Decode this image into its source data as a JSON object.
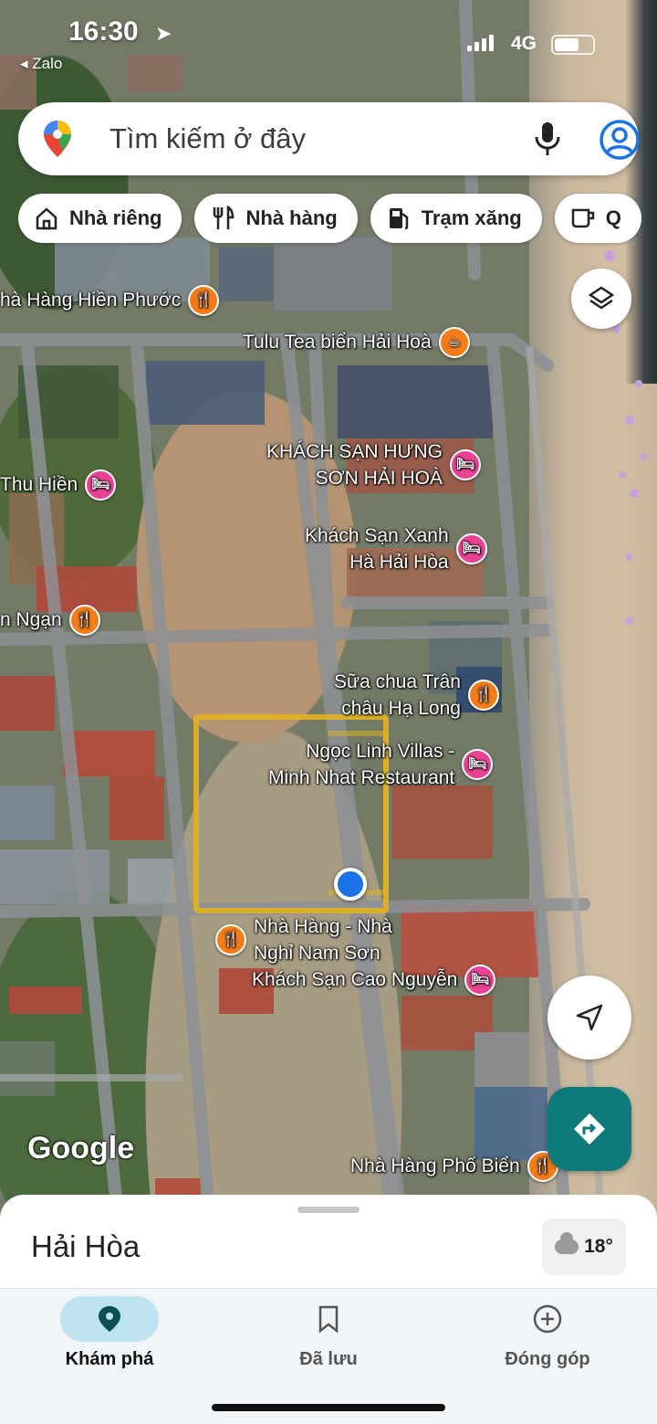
{
  "status_bar": {
    "time": "16:30",
    "back_app": "◂ Zalo",
    "network": "4G"
  },
  "search": {
    "placeholder": "Tìm kiếm ở đây",
    "icons": [
      "maps-pin-icon",
      "mic-icon",
      "account-icon"
    ]
  },
  "chips": [
    {
      "label": "Nhà riêng",
      "icon": "home-icon"
    },
    {
      "label": "Nhà hàng",
      "icon": "restaurant-icon"
    },
    {
      "label": "Trạm xăng",
      "icon": "gas-station-icon"
    },
    {
      "label": "Q",
      "icon": "cafe-icon"
    }
  ],
  "map_labels": {
    "hien_phuoc": "hà Hàng Hiền Phước",
    "tulu": "Tulu Tea biển Hải Hoà",
    "hung_son": "KHÁCH SẠN HƯNG\nSƠN HẢI HOÀ",
    "thu_hien": "Thu Hiền",
    "xanh_ha": "Khách Sạn Xanh\nHà Hải Hòa",
    "ngan": "n Ngạn",
    "sua_chua": "Sữa chua Trân\nchâu Hạ Long",
    "ngoc_linh": "Ngọc Linh Villas -\nMinh Nhat Restaurant",
    "nam_son": "Nhà Hàng - Nhà\nNghỉ Nam Sơn",
    "cao_nguyen": "Khách Sạn Cao Nguyễn",
    "pho_bien": "Nhà Hàng Phố Biển"
  },
  "map_brand": "Google",
  "colors": {
    "highlight": "#e4b320",
    "location_dot": "#1a73e8",
    "directions_fab": "#0e7a7a",
    "food_pin": "#f57c19",
    "hotel_pin": "#e84393",
    "nav_active": "#bde3f0"
  },
  "sheet": {
    "place": "Hải Hòa",
    "temperature": "18°"
  },
  "nav": [
    {
      "label": "Khám phá",
      "icon": "explore-pin-icon",
      "active": true
    },
    {
      "label": "Đã lưu",
      "icon": "bookmark-icon",
      "active": false
    },
    {
      "label": "Đóng góp",
      "icon": "add-circle-icon",
      "active": false
    }
  ]
}
